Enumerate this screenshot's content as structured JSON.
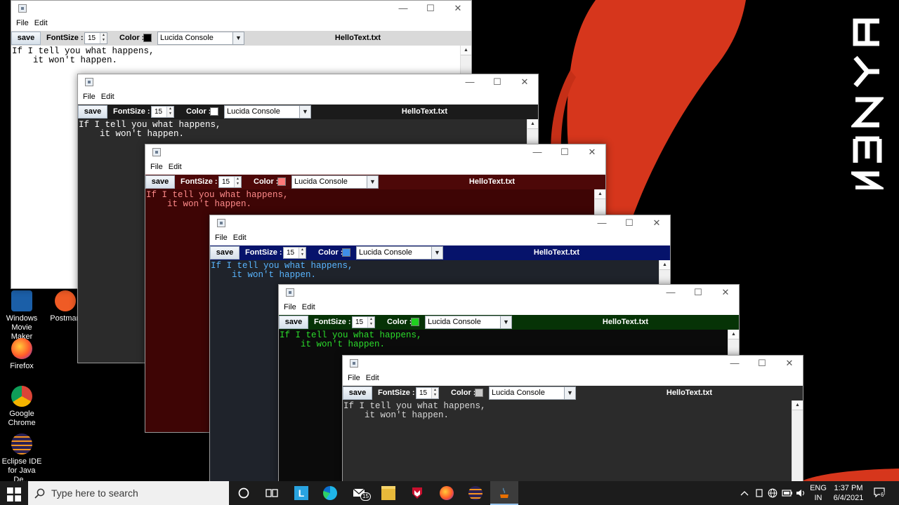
{
  "wallpaper": {
    "brand_text": "RYZEN",
    "colors": {
      "background": "#000000",
      "stripe": "#d6361c"
    }
  },
  "desktop_icons": [
    {
      "label": "Windows Movie Maker",
      "icon": "movie-maker-icon"
    },
    {
      "label": "Postman",
      "icon": "postman-icon"
    },
    {
      "label": "Firefox",
      "icon": "firefox-icon"
    },
    {
      "label": "Google Chrome",
      "icon": "chrome-icon"
    },
    {
      "label": "Eclipse IDE for Java De...",
      "icon": "eclipse-icon"
    }
  ],
  "windows": [
    {
      "menu": [
        "File",
        "Edit"
      ],
      "toolbar": {
        "save": "save",
        "font_size_label": "FontSize :",
        "font_size": "15",
        "color_label": "Color :",
        "font": "Lucida Console",
        "filename": "HelloText.txt"
      },
      "text": "If I tell you what happens,\n    it won't happen.",
      "theme": {
        "toolbar_bg": "#d9d9d9",
        "toolbar_fg": "#000000",
        "editor_bg": "#ffffff",
        "editor_fg": "#000000",
        "swatch": "#000000"
      }
    },
    {
      "menu": [
        "File",
        "Edit"
      ],
      "toolbar": {
        "save": "save",
        "font_size_label": "FontSize :",
        "font_size": "15",
        "color_label": "Color :",
        "font": "Lucida Console",
        "filename": "HelloText.txt"
      },
      "text": "If I tell you what happens,\n    it won't happen.",
      "theme": {
        "toolbar_bg": "#1b1b1b",
        "toolbar_fg": "#ffffff",
        "editor_bg": "#2b2b2b",
        "editor_fg": "#ffffff",
        "swatch": "#ffffff"
      }
    },
    {
      "menu": [
        "File",
        "Edit"
      ],
      "toolbar": {
        "save": "save",
        "font_size_label": "FontSize :",
        "font_size": "15",
        "color_label": "Color :",
        "font": "Lucida Console",
        "filename": "HelloText.txt"
      },
      "text": "If I tell you what happens,\n    it won't happen.",
      "theme": {
        "toolbar_bg": "#4d0808",
        "toolbar_fg": "#ffffff",
        "editor_bg": "#3e0505",
        "editor_fg": "#ff8a8a",
        "swatch": "#ff7a7a"
      }
    },
    {
      "menu": [
        "File",
        "Edit"
      ],
      "toolbar": {
        "save": "save",
        "font_size_label": "FontSize :",
        "font_size": "15",
        "color_label": "Color :",
        "font": "Lucida Console",
        "filename": "HelloText.txt"
      },
      "text": "If I tell you what happens,\n    it won't happen.",
      "theme": {
        "toolbar_bg": "#06136b",
        "toolbar_fg": "#ffffff",
        "editor_bg": "#1f232b",
        "editor_fg": "#59b5ff",
        "swatch": "#3f8fe8"
      }
    },
    {
      "menu": [
        "File",
        "Edit"
      ],
      "toolbar": {
        "save": "save",
        "font_size_label": "FontSize :",
        "font_size": "15",
        "color_label": "Color :",
        "font": "Lucida Console",
        "filename": "HelloText.txt"
      },
      "text": "If I tell you what happens,\n    it won't happen.",
      "theme": {
        "toolbar_bg": "#063306",
        "toolbar_fg": "#ffffff",
        "editor_bg": "#0b0b0b",
        "editor_fg": "#2bdc2b",
        "swatch": "#1fd01f"
      }
    },
    {
      "menu": [
        "File",
        "Edit"
      ],
      "toolbar": {
        "save": "save",
        "font_size_label": "FontSize :",
        "font_size": "15",
        "color_label": "Color :",
        "font": "Lucida Console",
        "filename": "HelloText.txt"
      },
      "text": "If I tell you what happens,\n    it won't happen.",
      "theme": {
        "toolbar_bg": "#2b2b2b",
        "toolbar_fg": "#ffffff",
        "editor_bg": "#2b2b2b",
        "editor_fg": "#d8d8d8",
        "swatch": "#c8c8c8"
      }
    }
  ],
  "taskbar": {
    "search_placeholder": "Type here to search",
    "mail_badge": "15",
    "lang_primary": "ENG",
    "lang_secondary": "IN",
    "time": "1:37 PM",
    "date": "6/4/2021",
    "notification_count": "6"
  }
}
